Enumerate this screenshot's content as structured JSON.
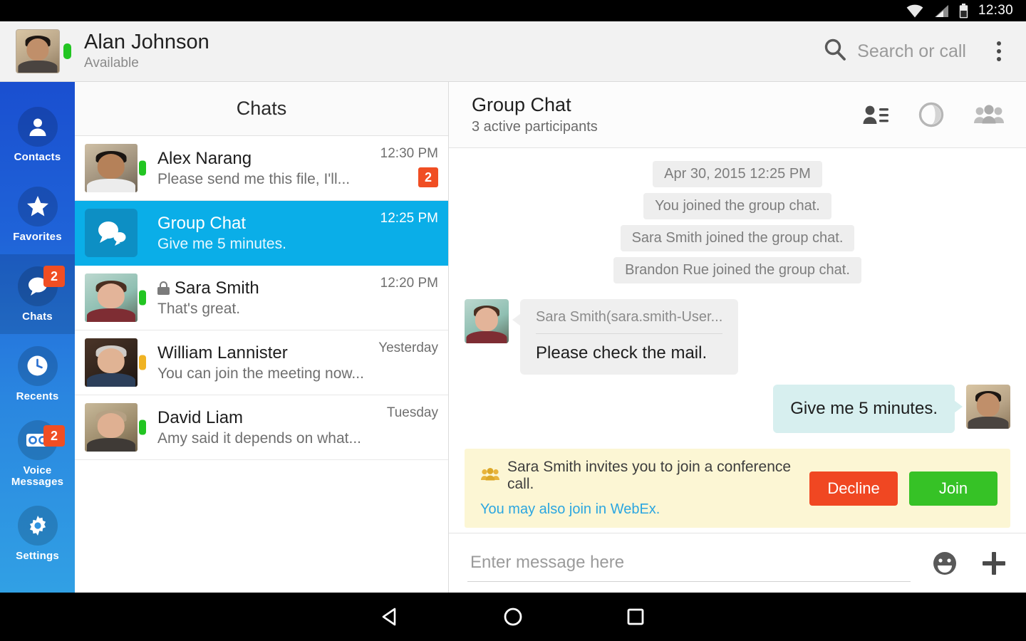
{
  "statusbar": {
    "time": "12:30",
    "icons": [
      "wifi-icon",
      "cellular-signal-icon",
      "battery-icon"
    ]
  },
  "appbar": {
    "user_name": "Alan Johnson",
    "user_status": "Available",
    "presence_color": "#22c522",
    "search_placeholder": "Search or call",
    "search_icon": "search-icon",
    "overflow_icon": "overflow-menu-icon"
  },
  "sidebar": {
    "items": [
      {
        "label": "Contacts",
        "icon": "person-icon",
        "badge": "",
        "active": false
      },
      {
        "label": "Favorites",
        "icon": "star-icon",
        "badge": "",
        "active": false
      },
      {
        "label": "Chats",
        "icon": "chat-bubble-icon",
        "badge": "2",
        "active": true
      },
      {
        "label": "Recents",
        "icon": "clock-icon",
        "badge": "",
        "active": false
      },
      {
        "label": "Voice Messages",
        "icon": "voicemail-icon",
        "badge": "2",
        "active": false
      },
      {
        "label": "Settings",
        "icon": "gear-icon",
        "badge": "",
        "active": false
      }
    ],
    "badge_color": "#f04e23",
    "gradient_top": "#1a4fd0",
    "gradient_bottom": "#31a0e4"
  },
  "chatlist": {
    "title": "Chats",
    "selected_color": "#0aaee8",
    "rows": [
      {
        "name": "Alex Narang",
        "preview": "Please send me this file, I'll...",
        "time": "12:30 PM",
        "badge": "2",
        "presence": "available",
        "locked": false,
        "avatar": "photo",
        "selected": false
      },
      {
        "name": "Group Chat",
        "preview": "Give me 5 minutes.",
        "time": "12:25 PM",
        "badge": "",
        "presence": "",
        "locked": false,
        "avatar": "group-chat-icon",
        "selected": true
      },
      {
        "name": "Sara Smith",
        "preview": "That's great.",
        "time": "12:20 PM",
        "badge": "",
        "presence": "available",
        "locked": true,
        "avatar": "photo",
        "selected": false
      },
      {
        "name": "William Lannister",
        "preview": "You can join the meeting now...",
        "time": "Yesterday",
        "badge": "",
        "presence": "away",
        "locked": false,
        "avatar": "photo",
        "selected": false
      },
      {
        "name": "David Liam",
        "preview": "Amy said it depends on what...",
        "time": "Tuesday",
        "badge": "",
        "presence": "available",
        "locked": false,
        "avatar": "photo",
        "selected": false
      }
    ]
  },
  "conversation": {
    "title": "Group Chat",
    "subtitle": "3 active participants",
    "header_icons": [
      "participant-list-icon",
      "call-circle-icon",
      "add-people-icon"
    ],
    "system_messages": [
      "Apr 30, 2015 12:25 PM",
      "You joined the group chat.",
      "Sara Smith joined the group chat.",
      "Brandon Rue joined the group chat."
    ],
    "messages": [
      {
        "direction": "in",
        "sender": "Sara Smith(sara.smith-User...",
        "text": "Please check the mail.",
        "avatar": "photo"
      },
      {
        "direction": "out",
        "sender": "",
        "text": "Give me 5 minutes.",
        "avatar": "photo"
      }
    ],
    "invite": {
      "icon": "group-people-icon",
      "text": "Sara Smith invites you to join a conference call.",
      "link": "You may also join in WebEx.",
      "decline_label": "Decline",
      "join_label": "Join",
      "decline_color": "#f04722",
      "join_color": "#36c226",
      "background": "#fcf6d4"
    },
    "composer": {
      "placeholder": "Enter message here",
      "value": "",
      "emoji_icon": "emoji-smiley-icon",
      "add_icon": "plus-icon"
    }
  },
  "navbar": {
    "buttons": [
      "back-triangle-icon",
      "home-circle-icon",
      "recents-square-icon"
    ]
  }
}
